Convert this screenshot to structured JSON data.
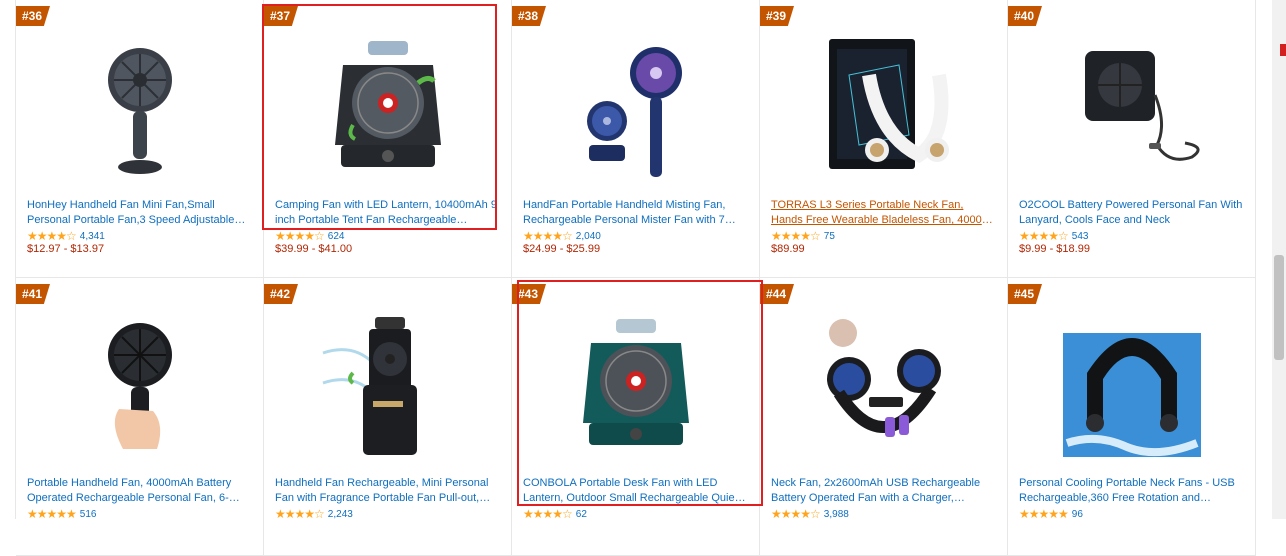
{
  "products": [
    {
      "rank": "#36",
      "title": "HonHey Handheld Fan Mini Fan,Small Personal Portable Fan,3 Speed Adjustable USB Desk…",
      "rating": "★★★★☆",
      "count": "4,341",
      "price": "$12.97 - $13.97",
      "icon": "handheld-fan-icon"
    },
    {
      "rank": "#37",
      "title": "Camping Fan with LED Lantern, 10400mAh 9 inch Portable Tent Fan Rechargeable…",
      "rating": "★★★★☆",
      "count": "624",
      "price": "$39.99 - $41.00",
      "icon": "camping-fan-icon"
    },
    {
      "rank": "#38",
      "title": "HandFan Portable Handheld Misting Fan, Rechargeable Personal Mister Fan with 7…",
      "rating": "★★★★☆",
      "count": "2,040",
      "price": "$24.99 - $25.99",
      "icon": "misting-fan-icon"
    },
    {
      "rank": "#39",
      "title": "TORRAS L3 Series Portable Neck Fan, Hands Free Wearable Bladeless Fan, 4000 mAh…",
      "rating": "★★★★☆",
      "count": "75",
      "price": "$89.99",
      "icon": "neck-fan-icon"
    },
    {
      "rank": "#40",
      "title": "O2COOL Battery Powered Personal Fan With Lanyard, Cools Face and Neck",
      "rating": "★★★★☆",
      "count": "543",
      "price": "$9.99 - $18.99",
      "icon": "lanyard-fan-icon"
    },
    {
      "rank": "#41",
      "title": "Portable Handheld Fan, 4000mAh Battery Operated Rechargeable Personal Fan, 6-15…",
      "rating": "★★★★★",
      "count": "516",
      "price": "",
      "icon": "handheld-fan-icon"
    },
    {
      "rank": "#42",
      "title": "Handheld Fan Rechargeable, Mini Personal Fan with Fragrance Portable Fan Pull-out, 3…",
      "rating": "★★★★☆",
      "count": "2,243",
      "price": "",
      "icon": "pullout-fan-icon"
    },
    {
      "rank": "#43",
      "title": "CONBOLA Portable Desk Fan with LED Lantern, Outdoor Small Rechargeable Quiet Camping…",
      "rating": "★★★★☆",
      "count": "62",
      "price": "",
      "icon": "camping-fan-icon"
    },
    {
      "rank": "#44",
      "title": "Neck Fan, 2x2600mAh USB Rechargeable Battery Operated Fan with a Charger,…",
      "rating": "★★★★☆",
      "count": "3,988",
      "price": "",
      "icon": "neck-fan-icon"
    },
    {
      "rank": "#45",
      "title": "Personal Cooling Portable Neck Fans - USB Rechargeable,360 Free Rotation and Lower…",
      "rating": "★★★★★",
      "count": "96",
      "price": "",
      "icon": "neck-fan-icon"
    }
  ]
}
